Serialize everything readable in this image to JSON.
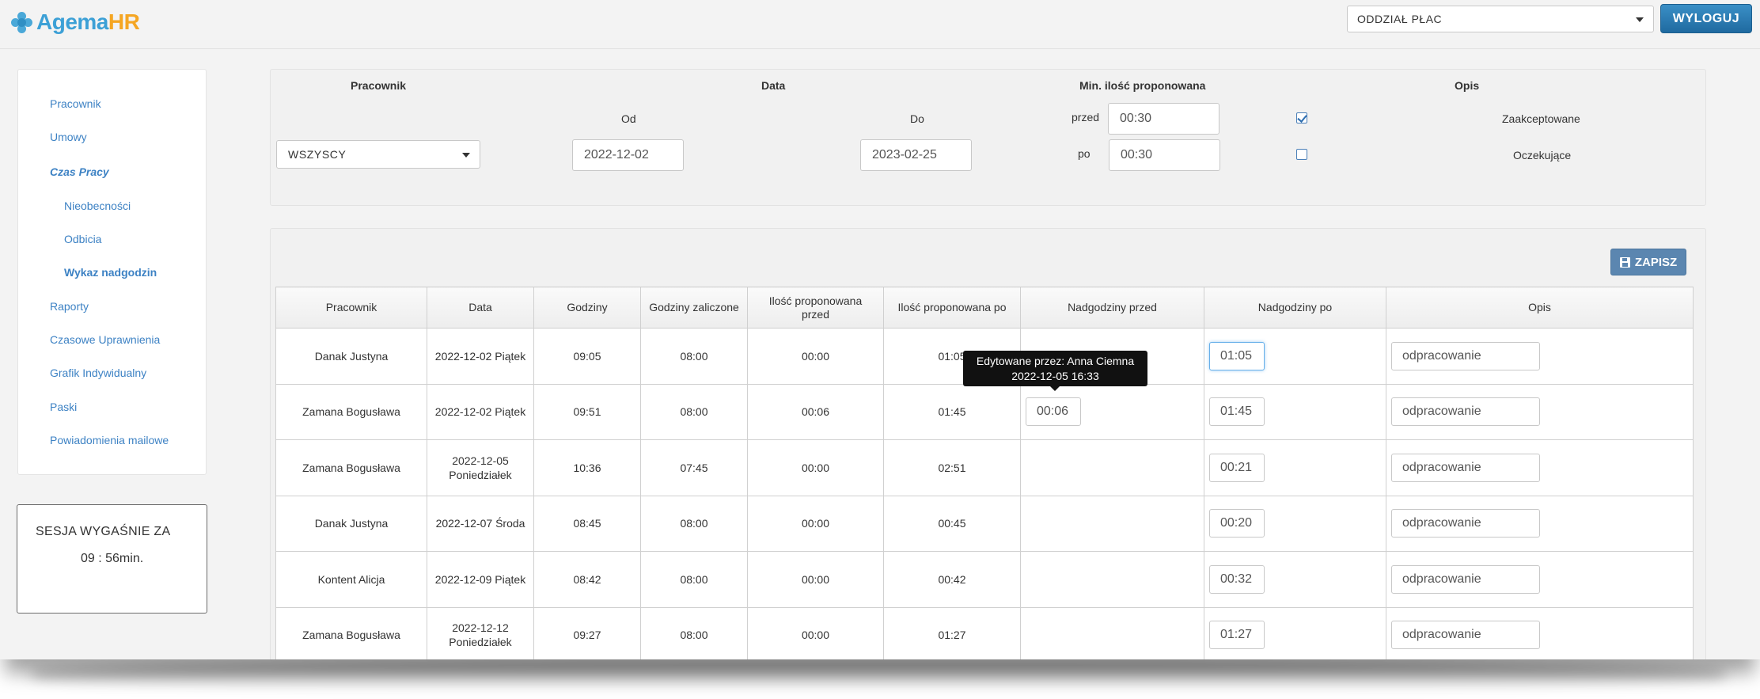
{
  "header": {
    "logo_agema": "Agema",
    "logo_hr": "HR",
    "department": "ODDZIAŁ PŁAC",
    "logout_label": "WYLOGUJ"
  },
  "sidebar": {
    "items": [
      {
        "label": "Pracownik"
      },
      {
        "label": "Umowy"
      },
      {
        "label": "Czas Pracy"
      },
      {
        "label": "Nieobecności"
      },
      {
        "label": "Odbicia"
      },
      {
        "label": "Wykaz nadgodzin"
      },
      {
        "label": "Raporty"
      },
      {
        "label": "Czasowe Uprawnienia"
      },
      {
        "label": "Grafik Indywidualny"
      },
      {
        "label": "Paski"
      },
      {
        "label": "Powiadomienia mailowe"
      }
    ]
  },
  "session": {
    "title": "SESJA WYGAŚNIE ZA",
    "remaining": "09 : 56min."
  },
  "filter": {
    "employee_header": "Pracownik",
    "date_header": "Data",
    "min_header": "Min. ilość proponowana",
    "desc_header": "Opis",
    "from_label": "Od",
    "to_label": "Do",
    "before_label": "przed",
    "after_label": "po",
    "employee_value": "WSZYSCY",
    "date_from": "2022-12-02",
    "date_to": "2023-02-25",
    "min_before": "00:30",
    "min_after": "00:30",
    "accepted_label": "Zaakceptowane",
    "accepted_checked": true,
    "pending_label": "Oczekujące",
    "pending_checked": false
  },
  "results": {
    "save_label": "ZAPISZ",
    "columns": [
      "Pracownik",
      "Data",
      "Godziny",
      "Godziny zaliczone",
      "Ilość proponowana przed",
      "Ilość proponowana po",
      "Nadgodziny przed",
      "Nadgodziny po",
      "Opis"
    ],
    "rows": [
      {
        "employee": "Danak Justyna",
        "date": "2022-12-02 Piątek",
        "hours": "09:05",
        "counted": "08:00",
        "prop_before": "00:00",
        "prop_after": "01:05",
        "ot_before": "",
        "ot_after": "01:05",
        "desc": "odpracowanie"
      },
      {
        "employee": "Zamana Bogusława",
        "date": "2022-12-02 Piątek",
        "hours": "09:51",
        "counted": "08:00",
        "prop_before": "00:06",
        "prop_after": "01:45",
        "ot_before": "00:06",
        "ot_after": "01:45",
        "desc": "odpracowanie"
      },
      {
        "employee": "Zamana Bogusława",
        "date": "2022-12-05 Poniedziałek",
        "hours": "10:36",
        "counted": "07:45",
        "prop_before": "00:00",
        "prop_after": "02:51",
        "ot_before": "",
        "ot_after": "00:21",
        "desc": "odpracowanie"
      },
      {
        "employee": "Danak Justyna",
        "date": "2022-12-07 Środa",
        "hours": "08:45",
        "counted": "08:00",
        "prop_before": "00:00",
        "prop_after": "00:45",
        "ot_before": "",
        "ot_after": "00:20",
        "desc": "odpracowanie"
      },
      {
        "employee": "Kontent Alicja",
        "date": "2022-12-09 Piątek",
        "hours": "08:42",
        "counted": "08:00",
        "prop_before": "00:00",
        "prop_after": "00:42",
        "ot_before": "",
        "ot_after": "00:32",
        "desc": "odpracowanie"
      },
      {
        "employee": "Zamana Bogusława",
        "date": "2022-12-12 Poniedziałek",
        "hours": "09:27",
        "counted": "08:00",
        "prop_before": "00:00",
        "prop_after": "01:27",
        "ot_before": "",
        "ot_after": "01:27",
        "desc": "odpracowanie"
      }
    ],
    "tooltip_line1": "Edytowane przez: Anna Ciemna",
    "tooltip_line2": "2022-12-05 16:33"
  }
}
